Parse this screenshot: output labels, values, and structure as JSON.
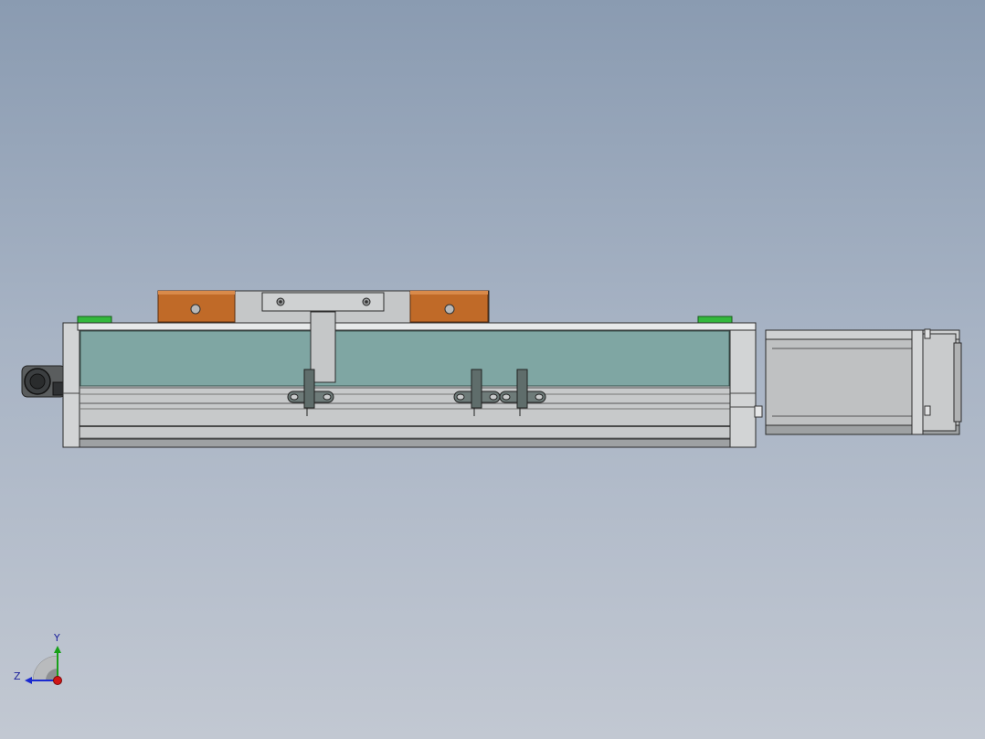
{
  "viewport": {
    "background_top": "#8a9bb1",
    "background_bottom": "#c2c8d2"
  },
  "colors": {
    "housing": "#c7c9ca",
    "cover_glass": "#7fa6a3",
    "clamp_block": "#c06a28",
    "end_marker": "#33b83c",
    "motor": "#bfc1c2",
    "bracket": "#5f6d6b"
  },
  "triad": {
    "y_label": "Y",
    "z_label": "Z",
    "x_axis_color": "#d01515",
    "y_axis_color": "#18a018",
    "z_axis_color": "#1a2ad0"
  }
}
